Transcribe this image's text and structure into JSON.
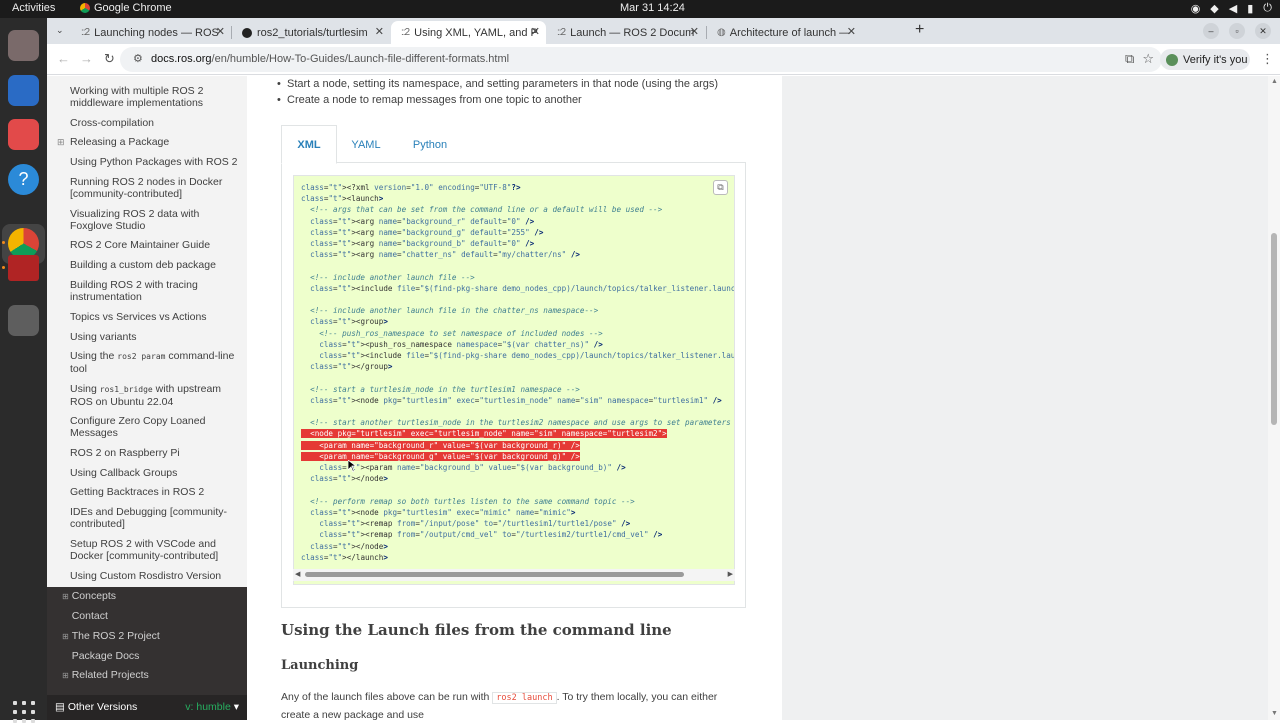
{
  "system_bar": {
    "activities": "Activities",
    "app_name": "Google Chrome",
    "clock": "Mar 31  14:24"
  },
  "tabs": [
    {
      "label": "Launching nodes — ROS",
      "favicon": "::2",
      "active": false
    },
    {
      "label": "ros2_tutorials/turtlesim",
      "favicon": "github-icon",
      "active": false
    },
    {
      "label": "Using XML, YAML, and P",
      "favicon": "::2",
      "active": true
    },
    {
      "label": "Launch — ROS 2 Docum",
      "favicon": "::2",
      "active": false
    },
    {
      "label": "Architecture of launch —",
      "favicon": "globe-icon",
      "active": false
    }
  ],
  "toolbar": {
    "url_host": "docs.ros.org",
    "url_path": "/en/humble/How-To-Guides/Launch-file-different-formats.html",
    "verify_label": "Verify it's you"
  },
  "sidebar": {
    "items": [
      {
        "label": "Working with multiple ROS 2 middleware implementations"
      },
      {
        "label": "Cross-compilation"
      },
      {
        "label": "Releasing a Package",
        "expandable": true
      },
      {
        "label": "Using Python Packages with ROS 2"
      },
      {
        "label": "Running ROS 2 nodes in Docker [community-contributed]"
      },
      {
        "label": "Visualizing ROS 2 data with Foxglove Studio"
      },
      {
        "label": "ROS 2 Core Maintainer Guide"
      },
      {
        "label": "Building a custom deb package"
      },
      {
        "label": "Building ROS 2 with tracing instrumentation"
      },
      {
        "label": "Topics vs Services vs Actions"
      },
      {
        "label": "Using variants"
      },
      {
        "label_pre": "Using the ",
        "label_code": "ros2 param",
        "label_post": " command-line tool"
      },
      {
        "label_pre": "Using ",
        "label_code": "ros1_bridge",
        "label_post": " with upstream ROS on Ubuntu 22.04"
      },
      {
        "label": "Configure Zero Copy Loaned Messages"
      },
      {
        "label": "ROS 2 on Raspberry Pi"
      },
      {
        "label": "Using Callback Groups"
      },
      {
        "label": "Getting Backtraces in ROS 2"
      },
      {
        "label": "IDEs and Debugging [community-contributed]"
      },
      {
        "label": "Setup ROS 2 with VSCode and Docker [community-contributed]"
      },
      {
        "label": "Using Custom Rosdistro Version"
      }
    ],
    "top_level": [
      {
        "label": "Concepts",
        "expandable": true
      },
      {
        "label": "Contact"
      },
      {
        "label": "The ROS 2 Project",
        "expandable": true
      },
      {
        "label": "Package Docs"
      },
      {
        "label": "Related Projects",
        "expandable": true
      }
    ],
    "versions_label": "Other Versions",
    "version_value": "v: humble"
  },
  "content": {
    "bullets": [
      "Start a node, setting its namespace, and setting parameters in that node (using the args)",
      "Create a node to remap messages from one topic to another"
    ],
    "code_tabs": [
      "XML",
      "YAML",
      "Python"
    ],
    "selected_tab": "XML",
    "code_lines": [
      "<?xml version=\"1.0\" encoding=\"UTF-8\"?>",
      "<launch>",
      "  <!-- args that can be set from the command line or a default will be used -->",
      "  <arg name=\"background_r\" default=\"0\" />",
      "  <arg name=\"background_g\" default=\"255\" />",
      "  <arg name=\"background_b\" default=\"0\" />",
      "  <arg name=\"chatter_ns\" default=\"my/chatter/ns\" />",
      "",
      "  <!-- include another launch file -->",
      "  <include file=\"$(find-pkg-share demo_nodes_cpp)/launch/topics/talker_listener.launch.py\" />",
      "",
      "  <!-- include another launch file in the chatter_ns namespace-->",
      "  <group>",
      "    <!-- push_ros_namespace to set namespace of included nodes -->",
      "    <push_ros_namespace namespace=\"$(var chatter_ns)\" />",
      "    <include file=\"$(find-pkg-share demo_nodes_cpp)/launch/topics/talker_listener.launch.py\" />",
      "  </group>",
      "",
      "  <!-- start a turtlesim_node in the turtlesim1 namespace -->",
      "  <node pkg=\"turtlesim\" exec=\"turtlesim_node\" name=\"sim\" namespace=\"turtlesim1\" />",
      "",
      "  <!-- start another turtlesim_node in the turtlesim2 namespace and use args to set parameters -->",
      "  <node pkg=\"turtlesim\" exec=\"turtlesim_node\" name=\"sim\" namespace=\"turtlesim2\">",
      "    <param name=\"background_r\" value=\"$(var background_r)\" />",
      "    <param name=\"background_g\" value=\"$(var background_g)\" />",
      "    <param name=\"background_b\" value=\"$(var background_b)\" />",
      "  </node>",
      "",
      "  <!-- perform remap so both turtles listen to the same command topic -->",
      "  <node pkg=\"turtlesim\" exec=\"mimic\" name=\"mimic\">",
      "    <remap from=\"/input/pose\" to=\"/turtlesim1/turtle1/pose\" />",
      "    <remap from=\"/output/cmd_vel\" to=\"/turtlesim2/turtle1/cmd_vel\" />",
      "  </node>",
      "</launch>"
    ],
    "section_title": "Using the Launch files from the command line",
    "subsection_title": "Launching",
    "paragraph_pre": "Any of the launch files above can be run with ",
    "paragraph_code": "ros2 launch",
    "paragraph_post": ". To try them locally, you can either",
    "paragraph_line2": "create a new package and use"
  }
}
